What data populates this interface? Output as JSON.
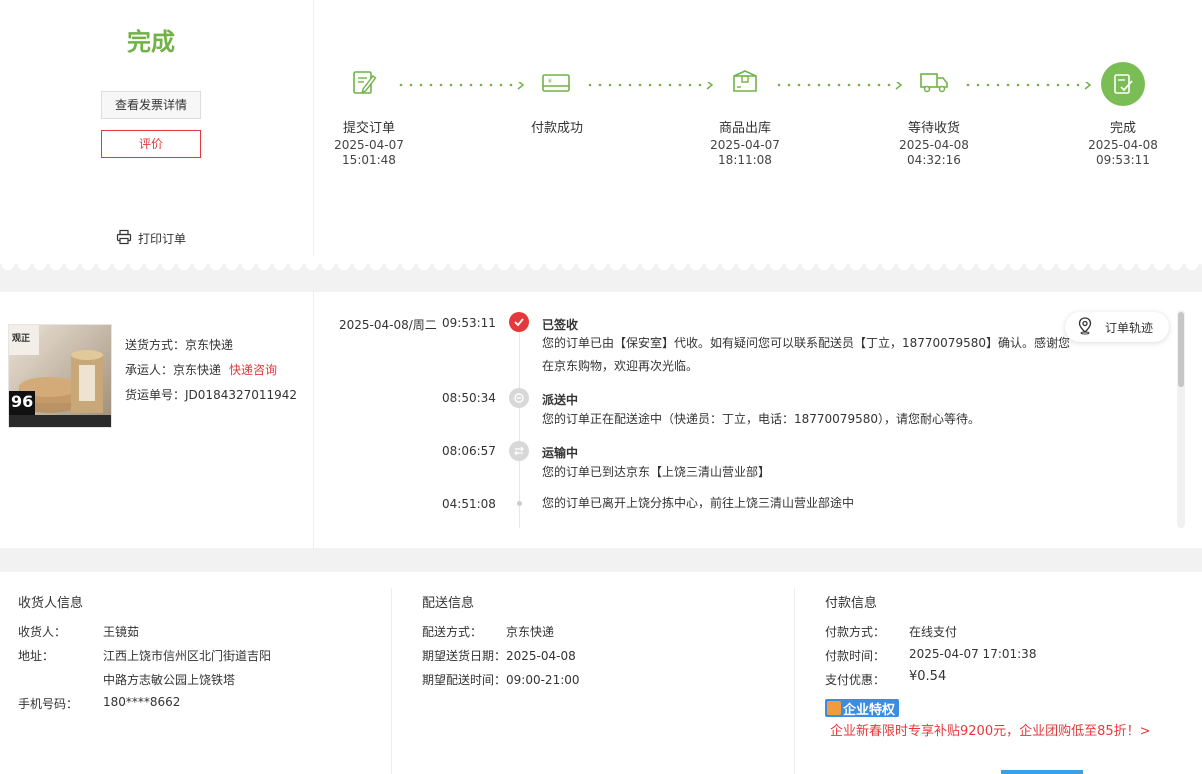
{
  "status": {
    "title": "完成",
    "invoice_button": "查看发票详情",
    "review_button": "评价",
    "print_label": "打印订单"
  },
  "progress": {
    "steps": [
      {
        "label": "提交订单",
        "date": "2025-04-07",
        "time": "15:01:48",
        "icon": "order-edit-icon"
      },
      {
        "label": "付款成功",
        "date": "",
        "time": "",
        "icon": "payment-card-icon"
      },
      {
        "label": "商品出库",
        "date": "2025-04-07",
        "time": "18:11:08",
        "icon": "package-box-icon"
      },
      {
        "label": "等待收货",
        "date": "2025-04-08",
        "time": "04:32:16",
        "icon": "delivery-truck-icon"
      },
      {
        "label": "完成",
        "date": "2025-04-08",
        "time": "09:53:11",
        "icon": "completed-check-icon"
      }
    ],
    "accent_color": "#71b247"
  },
  "shipping": {
    "method_label": "送货方式：",
    "method_value": "京东快递",
    "carrier_label": "承运人：",
    "carrier_value": "京东快递",
    "consult_link": "快递咨询",
    "tracking_label": "货运单号：",
    "tracking_value": "JD0184327011942",
    "product_badge": "96",
    "product_brand": "观正"
  },
  "tracking": {
    "date": "2025-04-08/周二",
    "track_button": "订单轨迹",
    "events": [
      {
        "time": "09:53:11",
        "title": "已签收",
        "text1": "您的订单已由【保安室】代收。如有疑问您可以联系配送员【丁立，18770079580】确认。感谢您",
        "text2": "在京东购物，欢迎再次光临。"
      },
      {
        "time": "08:50:34",
        "title": "派送中",
        "text1": "您的订单正在配送途中（快递员：丁立，电话：18770079580），请您耐心等待。"
      },
      {
        "time": "08:06:57",
        "title": "运输中",
        "text1": "您的订单已到达京东【上饶三清山营业部】"
      },
      {
        "time": "04:51:08",
        "title": "",
        "text1": "您的订单已离开上饶分拣中心，前往上饶三清山营业部途中"
      }
    ]
  },
  "receiver": {
    "title": "收货人信息",
    "name_label": "收货人：",
    "name_value": "王镜茹",
    "address_label": "地址：",
    "address_line1": "江西上饶市信州区北门街道吉阳",
    "address_line2": "中路方志敏公园上饶铁塔",
    "phone_label": "手机号码：",
    "phone_value": "180****8662"
  },
  "delivery": {
    "title": "配送信息",
    "method_label": "配送方式：",
    "method_value": "京东快递",
    "date_label": "期望送货日期：",
    "date_value": "2025-04-08",
    "time_label": "期望配送时间：",
    "time_value": "09:00-21:00"
  },
  "payment": {
    "title": "付款信息",
    "method_label": "付款方式：",
    "method_value": "在线支付",
    "time_label": "付款时间：",
    "time_value": "2025-04-07 17:01:38",
    "discount_label": "支付优惠：",
    "discount_value": "¥0.54",
    "badge": "企业特权",
    "promo": "企业新春限时专享补贴9200元，企业团购低至85折！>"
  }
}
